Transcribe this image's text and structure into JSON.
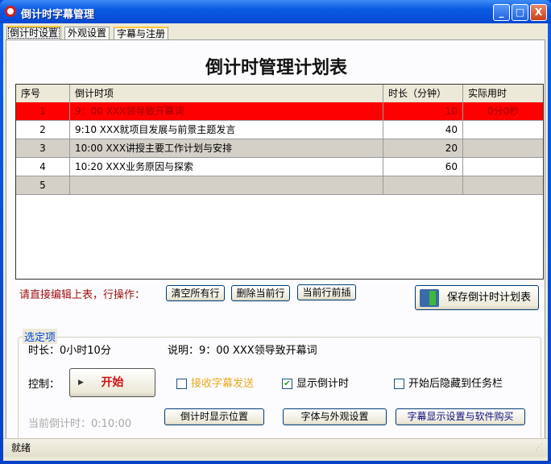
{
  "window": {
    "title": "倒计时字幕管理",
    "minimize": "_",
    "maximize": "□",
    "close": "X"
  },
  "tabs": [
    "倒计时设置",
    "外观设置",
    "字幕与注册"
  ],
  "heading": "倒计时管理计划表",
  "table": {
    "headers": [
      "序号",
      "倒计时项",
      "时长（分钟）",
      "实际用时"
    ],
    "rows": [
      {
        "no": "1",
        "item": "9：00 XXX领导致开幕词",
        "minutes": "10",
        "actual": "0分0秒"
      },
      {
        "no": "2",
        "item": "9:10  XXX就项目发展与前景主题发言",
        "minutes": "40",
        "actual": ""
      },
      {
        "no": "3",
        "item": "10:00 XXX讲授主要工作计划与安排",
        "minutes": "20",
        "actual": ""
      },
      {
        "no": "4",
        "item": "10:20 XXX业务原因与探索",
        "minutes": "60",
        "actual": ""
      },
      {
        "no": "5",
        "item": "",
        "minutes": "",
        "actual": ""
      }
    ]
  },
  "row_ops": {
    "label": "请直接编辑上表，行操作：",
    "clear": "清空所有行",
    "delete": "删除当前行",
    "insert": "当前行前插"
  },
  "save_button": "保存倒计时计划表",
  "selection": {
    "legend": "选定项",
    "duration": "时长：0小时10分",
    "description": "说明：9：00 XXX领导致开幕词",
    "control_label": "控制：",
    "start": "开始",
    "receive_subtitle": {
      "label": "接收字幕发送",
      "checked": false
    },
    "show_countdown": {
      "label": "显示倒计时",
      "checked": true
    },
    "hide_taskbar": {
      "label": "开始后隐藏到任务栏",
      "checked": false
    },
    "current_countdown": "当前倒计时：0:10:00",
    "position_button": "倒计时显示位置",
    "font_button": "字体与外观设置",
    "purchase_button": "字幕显示设置与软件购买"
  },
  "status": "就绪"
}
